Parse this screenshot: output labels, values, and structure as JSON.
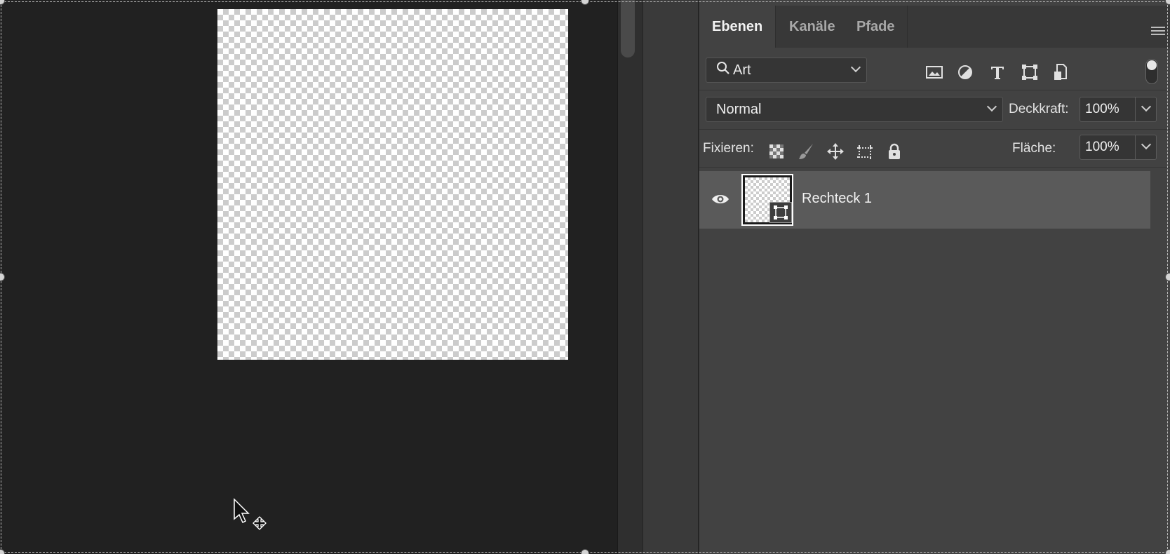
{
  "panel": {
    "tabs": [
      {
        "label": "Ebenen",
        "active": true
      },
      {
        "label": "Kanäle",
        "active": false
      },
      {
        "label": "Pfade",
        "active": false
      }
    ],
    "filter": {
      "kind_label": "Art",
      "icons": [
        "image-filter-icon",
        "adjustment-filter-icon",
        "type-filter-icon",
        "shape-filter-icon",
        "smart-object-filter-icon"
      ]
    },
    "blend_mode": "Normal",
    "opacity_label": "Deckkraft:",
    "opacity_value": "100%",
    "lock_label": "Fixieren:",
    "fill_label": "Fläche:",
    "fill_value": "100%",
    "layers": [
      {
        "name": "Rechteck 1",
        "visible": true,
        "type": "shape"
      }
    ]
  },
  "colors": {
    "canvas_bg": "#212121",
    "panel_bg": "#424242",
    "selected_row": "#5a5a5a"
  }
}
